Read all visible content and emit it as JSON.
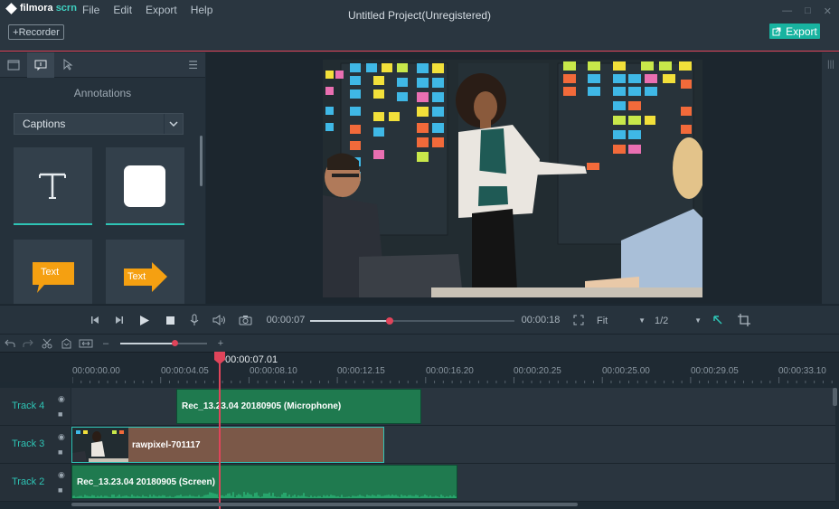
{
  "app": {
    "logo_word": "filmora",
    "logo_suffix": "scrn",
    "menu": [
      "File",
      "Edit",
      "Export",
      "Help"
    ],
    "recorder_label": "+Recorder",
    "window_title": "Untitled Project(Unregistered)",
    "export_label": "Export"
  },
  "left_panel": {
    "heading": "Annotations",
    "category_select": "Captions",
    "cards": [
      {
        "icon": "text-t-icon"
      },
      {
        "icon": "rounded-square-icon"
      },
      {
        "icon": "speech-callout-icon",
        "label": "Text"
      },
      {
        "icon": "arrow-callout-icon",
        "label": "Text"
      }
    ]
  },
  "player": {
    "current_time": "00:00:07",
    "total_time": "00:00:18",
    "fit_option": "Fit",
    "quality_option": "1/2",
    "progress_fraction": 0.39
  },
  "timeline": {
    "playhead_time": "00:00:07.01",
    "zoom_fraction": 0.62,
    "ruler_labels": [
      "00:00:00.00",
      "00:00:04.05",
      "00:00:08.10",
      "00:00:12.15",
      "00:00:16.20",
      "00:00:20.25",
      "00:00:25.00",
      "00:00:29.05",
      "00:00:33.10"
    ],
    "tracks": [
      {
        "name": "Track 4",
        "clip_label": "Rec_13.23.04 20180905 (Microphone)"
      },
      {
        "name": "Track 3",
        "clip_label": "rawpixel-701117"
      },
      {
        "name": "Track 2",
        "clip_label": "Rec_13.23.04 20180905 (Screen)"
      }
    ]
  },
  "colors": {
    "accent_teal": "#18b3a0",
    "accent_red": "#e0445a",
    "clip_green": "#1f7a4f",
    "clip_brown": "#7b5848"
  }
}
